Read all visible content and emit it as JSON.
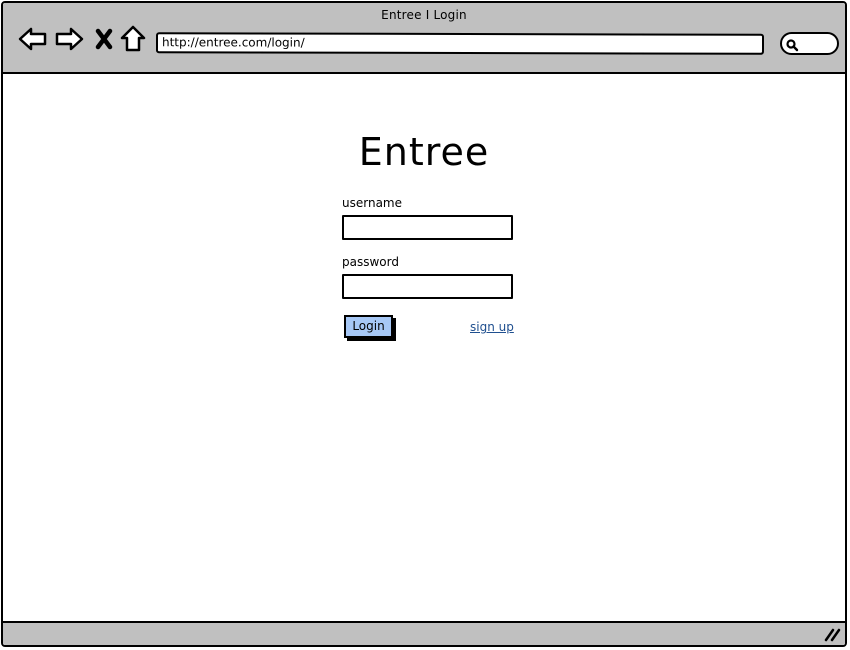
{
  "window": {
    "title": "Entree I Login",
    "address": "http://entree.com/login/"
  },
  "toolbar": {
    "icons": [
      "back-arrow-icon",
      "forward-arrow-icon",
      "close-x-icon",
      "home-icon",
      "search-icon"
    ]
  },
  "login_form": {
    "brand": "Entree",
    "username_label": "username",
    "username_value": "",
    "password_label": "password",
    "password_value": "",
    "login_button": "Login",
    "signup_link": "sign up"
  },
  "colors": {
    "chrome": "#c0c0c0",
    "button": "#a7c8f6",
    "link": "#1f4f8f"
  }
}
